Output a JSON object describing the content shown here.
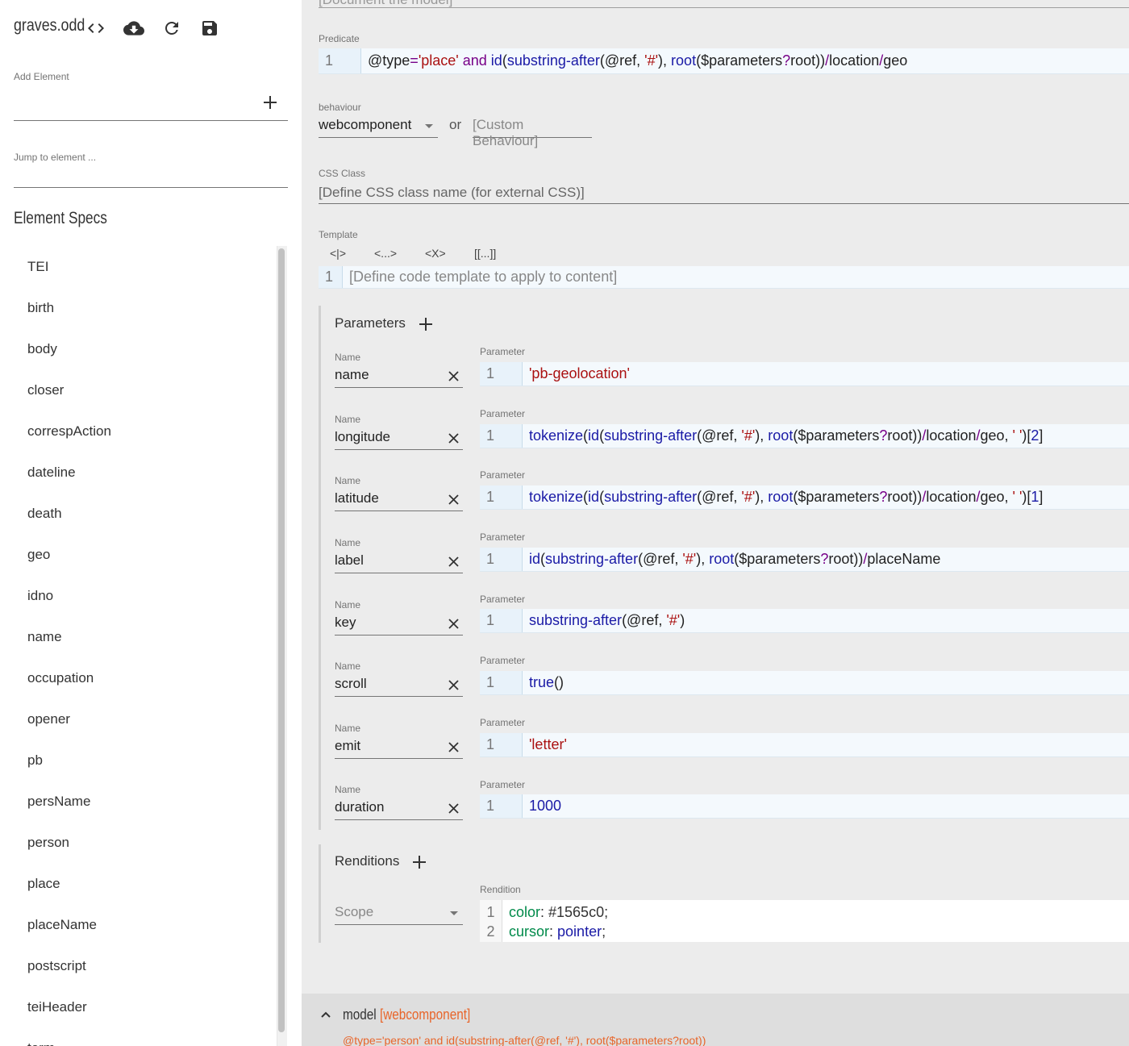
{
  "sidebar": {
    "odd_name": "graves.odd",
    "add_element_label": "Add Element",
    "jump_label": "Jump to element ...",
    "specs_title": "Element Specs",
    "spec_items": [
      "TEI",
      "birth",
      "body",
      "closer",
      "correspAction",
      "dateline",
      "death",
      "geo",
      "idno",
      "name",
      "occupation",
      "opener",
      "pb",
      "persName",
      "person",
      "place",
      "placeName",
      "postscript",
      "teiHeader",
      "term"
    ]
  },
  "toolbar": {
    "icons": [
      "code-icon",
      "cloud-download-icon",
      "refresh-icon",
      "save-icon"
    ]
  },
  "main": {
    "top_ghost": "[Document the model]",
    "predicate": {
      "label": "Predicate",
      "line": "1"
    },
    "behaviour": {
      "label": "behaviour",
      "value": "webcomponent",
      "or": "or",
      "custom_placeholder": "[Custom Behaviour]"
    },
    "css_class": {
      "label": "CSS Class",
      "placeholder": "[Define CSS class name (for external CSS)]"
    },
    "template": {
      "label": "Template",
      "buttons": [
        "<|>",
        "<...>",
        "<X>",
        "[[...]]"
      ],
      "line": "1",
      "placeholder": "[Define code template to apply to content]"
    },
    "parameters": {
      "title": "Parameters",
      "name_label": "Name",
      "param_label": "Parameter",
      "items": [
        {
          "name": "name",
          "line": "1"
        },
        {
          "name": "longitude",
          "line": "1"
        },
        {
          "name": "latitude",
          "line": "1"
        },
        {
          "name": "label",
          "line": "1"
        },
        {
          "name": "key",
          "line": "1"
        },
        {
          "name": "scroll",
          "line": "1"
        },
        {
          "name": "emit",
          "line": "1"
        },
        {
          "name": "duration",
          "line": "1"
        }
      ]
    },
    "renditions": {
      "title": "Renditions",
      "scope_placeholder": "Scope",
      "rendition_label": "Rendition",
      "lines": [
        "1",
        "2"
      ]
    },
    "model": {
      "title": "model",
      "behaviour": "[webcomponent]",
      "predicate": "@type='person' and id(substring-after(@ref, '#'), root($parameters?root))"
    }
  }
}
